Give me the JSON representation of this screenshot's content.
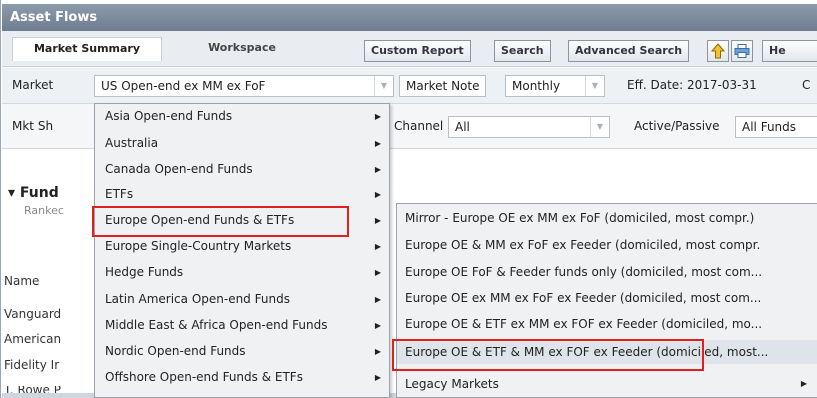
{
  "window": {
    "title": "Asset Flows"
  },
  "tabs": [
    {
      "label": "Market Summary",
      "active": true
    },
    {
      "label": "Workspace",
      "active": false
    }
  ],
  "toolbar": {
    "custom_report": "Custom Report",
    "search": "Search",
    "advanced_search": "Advanced Search",
    "export_icon": "export-icon",
    "print_icon": "print-icon",
    "help_partial": "He"
  },
  "filters": {
    "market_label": "Market",
    "market_value": "US Open-end ex MM ex FoF",
    "market_note": "Market Note",
    "frequency": "Monthly",
    "eff_date": "Eff. Date: 2017-03-31",
    "trailing": "C",
    "mktsh_label": "Mkt Sh",
    "channel_label": "Channel",
    "channel_value": "All",
    "active_passive_label": "Active/Passive",
    "active_passive_value": "All Funds"
  },
  "section": {
    "title_partial": "Fund",
    "subtitle_partial": "Rankec",
    "name_header": "Name",
    "rows": [
      "Vanguard",
      "American",
      "Fidelity Ir",
      "T. Rowe P"
    ]
  },
  "market_menu": [
    {
      "label": "Asia Open-end Funds",
      "has_sub": true
    },
    {
      "label": "Australia",
      "has_sub": true
    },
    {
      "label": "Canada Open-end Funds",
      "has_sub": true
    },
    {
      "label": "ETFs",
      "has_sub": true
    },
    {
      "label": "Europe Open-end Funds & ETFs",
      "has_sub": true,
      "highlighted": true
    },
    {
      "label": "Europe Single-Country Markets",
      "has_sub": true
    },
    {
      "label": "Hedge Funds",
      "has_sub": true
    },
    {
      "label": "Latin America Open-end Funds",
      "has_sub": true
    },
    {
      "label": "Middle East & Africa Open-end Funds",
      "has_sub": true
    },
    {
      "label": "Nordic Open-end Funds",
      "has_sub": true
    },
    {
      "label": "Offshore Open-end Funds & ETFs",
      "has_sub": true
    }
  ],
  "europe_submenu": [
    {
      "label": "Mirror - Europe OE ex MM ex FoF (domiciled, most compr.)"
    },
    {
      "label": "Europe OE & MM ex FoF ex Feeder (domiciled, most compr."
    },
    {
      "label": "Europe OE FoF & Feeder funds only (domiciled, most com..."
    },
    {
      "label": "Europe OE ex MM ex FoF ex Feeder (domiciled, most com..."
    },
    {
      "label": "Europe OE & ETF ex MM ex FOF ex Feeder (domiciled, mo..."
    },
    {
      "label": "Europe OE & ETF & MM ex FOF ex Feeder (domiciled, most...",
      "highlighted": true
    },
    {
      "label": "Legacy Markets",
      "has_sub": true
    }
  ],
  "colors": {
    "highlight_box": "#e0201c",
    "titlebar": "#7d8c9d"
  }
}
